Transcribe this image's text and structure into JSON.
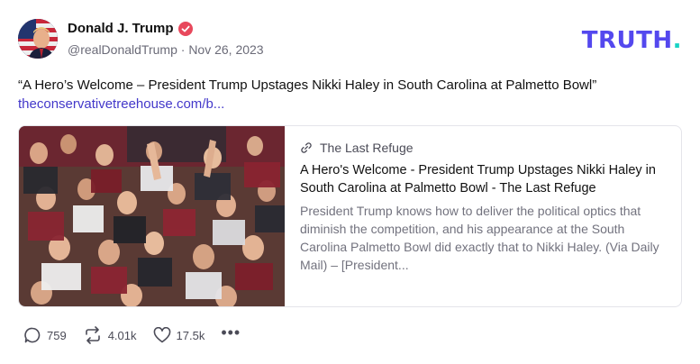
{
  "author": {
    "display_name": "Donald J. Trump",
    "handle": "@realDonaldTrump",
    "separator": "·",
    "date": "Nov 26, 2023",
    "avatar_icon": "avatar-flag-portrait",
    "verified_icon": "verified-badge-icon"
  },
  "brand": {
    "logo_text": "TRUTH",
    "logo_dot": ".",
    "color": "#5448ee",
    "dot_color": "#19d3c5"
  },
  "post": {
    "text": "“A Hero’s Welcome – President Trump Upstages Nikki Haley in South Carolina at Palmetto Bowl”",
    "link_text": "theconservativetreehouse.com/b..."
  },
  "link_card": {
    "source": "The Last Refuge",
    "title": "A Hero's Welcome - President Trump Upstages Nikki Haley in South Carolina at Palmetto Bowl - The Last Refuge",
    "description": "President Trump knows how to deliver the political optics that diminish the competition, and his appearance at the South Carolina Palmetto Bowl did exactly that to Nikki Haley. (Via Daily Mail) – [President..."
  },
  "actions": {
    "replies": "759",
    "retruths": "4.01k",
    "likes": "17.5k",
    "more": "•••"
  },
  "colors": {
    "link": "#4338ca",
    "muted": "#6b6b78",
    "border": "#e4e4ea"
  }
}
